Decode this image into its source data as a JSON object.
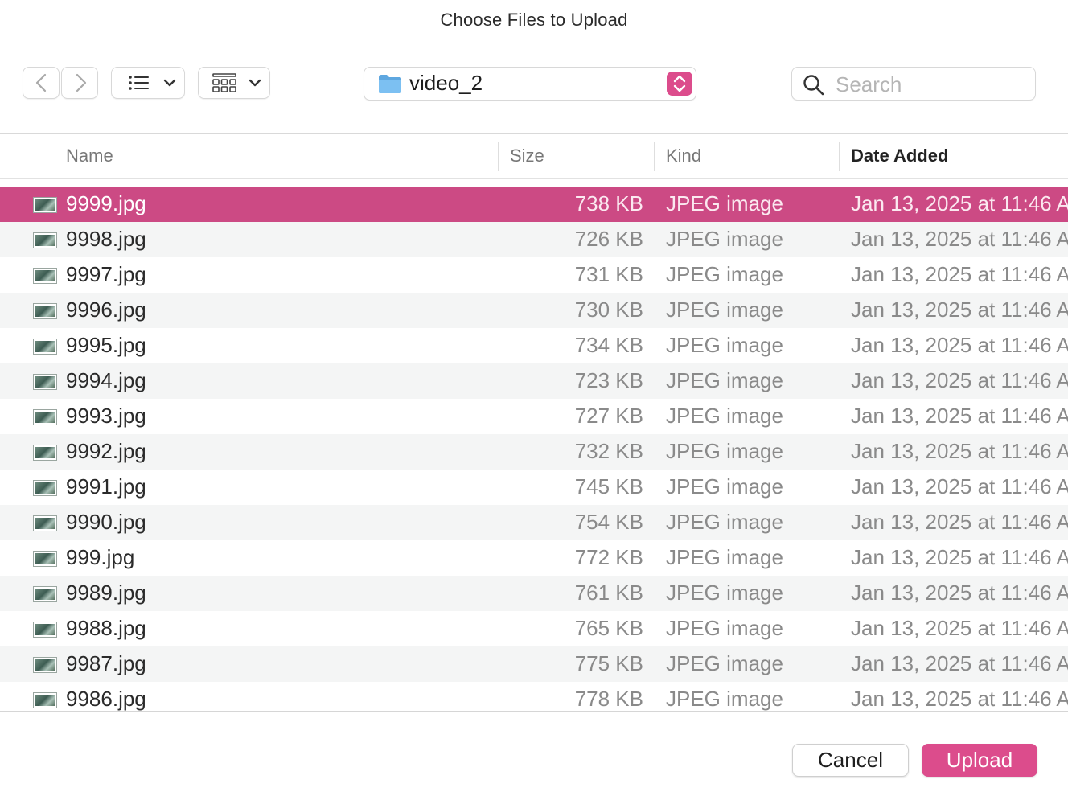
{
  "window": {
    "title": "Choose Files to Upload"
  },
  "colors": {
    "accent": "#dc4c8c",
    "selected": "#cc4a84"
  },
  "toolbar": {
    "back_icon": "chevron-left-icon",
    "forward_icon": "chevron-right-icon",
    "view_list_icon": "list-view-icon",
    "view_grid_icon": "grid-view-icon",
    "path": {
      "folder_icon": "folder-icon",
      "label": "video_2"
    },
    "search": {
      "placeholder": "Search",
      "value": ""
    }
  },
  "columns": {
    "name": "Name",
    "size": "Size",
    "kind": "Kind",
    "date_added": "Date Added",
    "sorted_by": "date_added"
  },
  "files": [
    {
      "name": "9999.jpg",
      "size": "738 KB",
      "kind": "JPEG image",
      "date": "Jan 13, 2025 at 11:46 A",
      "selected": true
    },
    {
      "name": "9998.jpg",
      "size": "726 KB",
      "kind": "JPEG image",
      "date": "Jan 13, 2025 at 11:46 A"
    },
    {
      "name": "9997.jpg",
      "size": "731 KB",
      "kind": "JPEG image",
      "date": "Jan 13, 2025 at 11:46 A"
    },
    {
      "name": "9996.jpg",
      "size": "730 KB",
      "kind": "JPEG image",
      "date": "Jan 13, 2025 at 11:46 A"
    },
    {
      "name": "9995.jpg",
      "size": "734 KB",
      "kind": "JPEG image",
      "date": "Jan 13, 2025 at 11:46 A"
    },
    {
      "name": "9994.jpg",
      "size": "723 KB",
      "kind": "JPEG image",
      "date": "Jan 13, 2025 at 11:46 A"
    },
    {
      "name": "9993.jpg",
      "size": "727 KB",
      "kind": "JPEG image",
      "date": "Jan 13, 2025 at 11:46 A"
    },
    {
      "name": "9992.jpg",
      "size": "732 KB",
      "kind": "JPEG image",
      "date": "Jan 13, 2025 at 11:46 A"
    },
    {
      "name": "9991.jpg",
      "size": "745 KB",
      "kind": "JPEG image",
      "date": "Jan 13, 2025 at 11:46 A"
    },
    {
      "name": "9990.jpg",
      "size": "754 KB",
      "kind": "JPEG image",
      "date": "Jan 13, 2025 at 11:46 A"
    },
    {
      "name": "999.jpg",
      "size": "772 KB",
      "kind": "JPEG image",
      "date": "Jan 13, 2025 at 11:46 A"
    },
    {
      "name": "9989.jpg",
      "size": "761 KB",
      "kind": "JPEG image",
      "date": "Jan 13, 2025 at 11:46 A"
    },
    {
      "name": "9988.jpg",
      "size": "765 KB",
      "kind": "JPEG image",
      "date": "Jan 13, 2025 at 11:46 A"
    },
    {
      "name": "9987.jpg",
      "size": "775 KB",
      "kind": "JPEG image",
      "date": "Jan 13, 2025 at 11:46 A"
    },
    {
      "name": "9986.jpg",
      "size": "778 KB",
      "kind": "JPEG image",
      "date": "Jan 13, 2025 at 11:46 A"
    }
  ],
  "buttons": {
    "cancel": "Cancel",
    "upload": "Upload"
  }
}
